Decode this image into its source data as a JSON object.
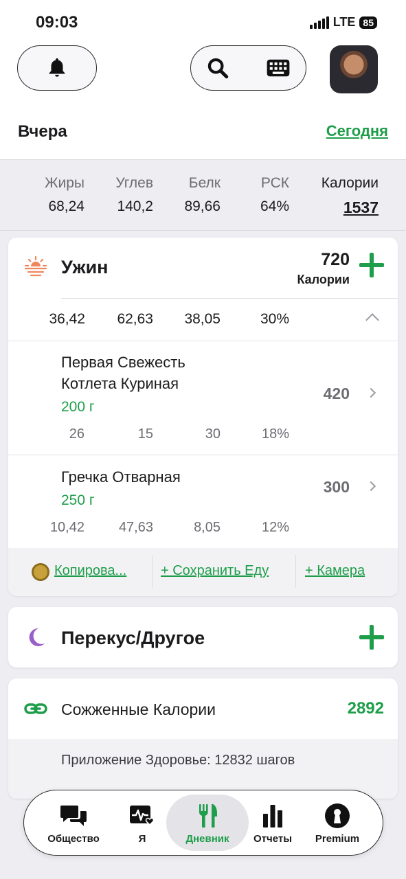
{
  "status_bar": {
    "time": "09:03",
    "network": "LTE",
    "battery": "85"
  },
  "header": {
    "icons": {
      "bell": "bell-icon",
      "search": "search-icon",
      "keyboard": "keyboard-icon"
    },
    "date_prev": "Вчера",
    "date_current": "Сегодня"
  },
  "summary": {
    "columns": [
      {
        "label": "Жиры",
        "value": "68,24"
      },
      {
        "label": "Углев",
        "value": "140,2"
      },
      {
        "label": "Белк",
        "value": "89,66"
      },
      {
        "label": "РСК",
        "value": "64%"
      },
      {
        "label": "Калории",
        "value": "1537"
      }
    ]
  },
  "dinner": {
    "title": "Ужин",
    "calories": "720",
    "calories_label": "Калории",
    "macros": [
      "36,42",
      "62,63",
      "38,05",
      "30%"
    ],
    "items": [
      {
        "name_line1": "Первая Свежесть",
        "name_line2": "Котлета Куриная",
        "portion": "200 г",
        "calories": "420",
        "macros": [
          "26",
          "15",
          "30",
          "18%"
        ]
      },
      {
        "name_line1": "Гречка Отварная",
        "portion": "250 г",
        "calories": "300",
        "macros": [
          "10,42",
          "47,63",
          "8,05",
          "12%"
        ]
      }
    ],
    "actions": {
      "copy": "Копирова...",
      "save": "+ Сохранить Еду",
      "camera": "+ Камера"
    }
  },
  "snack": {
    "title": "Перекус/Другое"
  },
  "burned": {
    "title": "Сожженные Калории",
    "value": "2892",
    "source": "Приложение Здоровье: 12832 шагов"
  },
  "nav": {
    "items": [
      {
        "label": "Общество",
        "icon": "chat-icon"
      },
      {
        "label": "Я",
        "icon": "health-icon"
      },
      {
        "label": "Дневник",
        "icon": "fork-knife-icon"
      },
      {
        "label": "Отчеты",
        "icon": "bar-chart-icon"
      },
      {
        "label": "Premium",
        "icon": "keyhole-icon"
      }
    ],
    "active": "Дневник"
  },
  "colors": {
    "accent": "#1e9e4a",
    "background": "#ededf2",
    "card": "#ffffff"
  }
}
